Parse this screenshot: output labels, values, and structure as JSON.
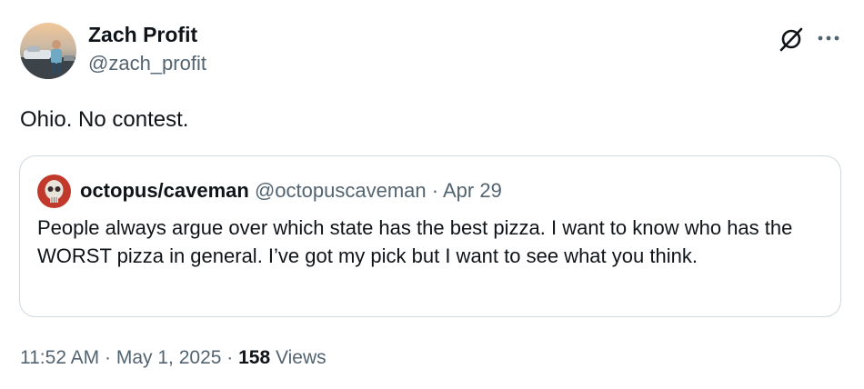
{
  "author": {
    "display_name": "Zach Profit",
    "handle": "@zach_profit",
    "avatar_icon": "avatar-photo"
  },
  "header_actions": {
    "grok_icon": "grok-icon",
    "more_icon": "more-options-icon"
  },
  "tweet": {
    "text": "Ohio. No contest."
  },
  "quoted": {
    "display_name": "octopus/caveman",
    "handle": "@octopuscaveman",
    "separator": "·",
    "date": "Apr 29",
    "text": "People always argue over which state has the best pizza. I want to know who has the WORST pizza in general. I’ve got my pick but I want to see what you think."
  },
  "footer": {
    "time": "11:52 AM",
    "sep1": "·",
    "date": "May 1, 2025",
    "sep2": "·",
    "views_count": "158",
    "views_label": "Views"
  },
  "colors": {
    "text_primary": "#0f1419",
    "text_secondary": "#536471",
    "border": "#cfd9de"
  }
}
